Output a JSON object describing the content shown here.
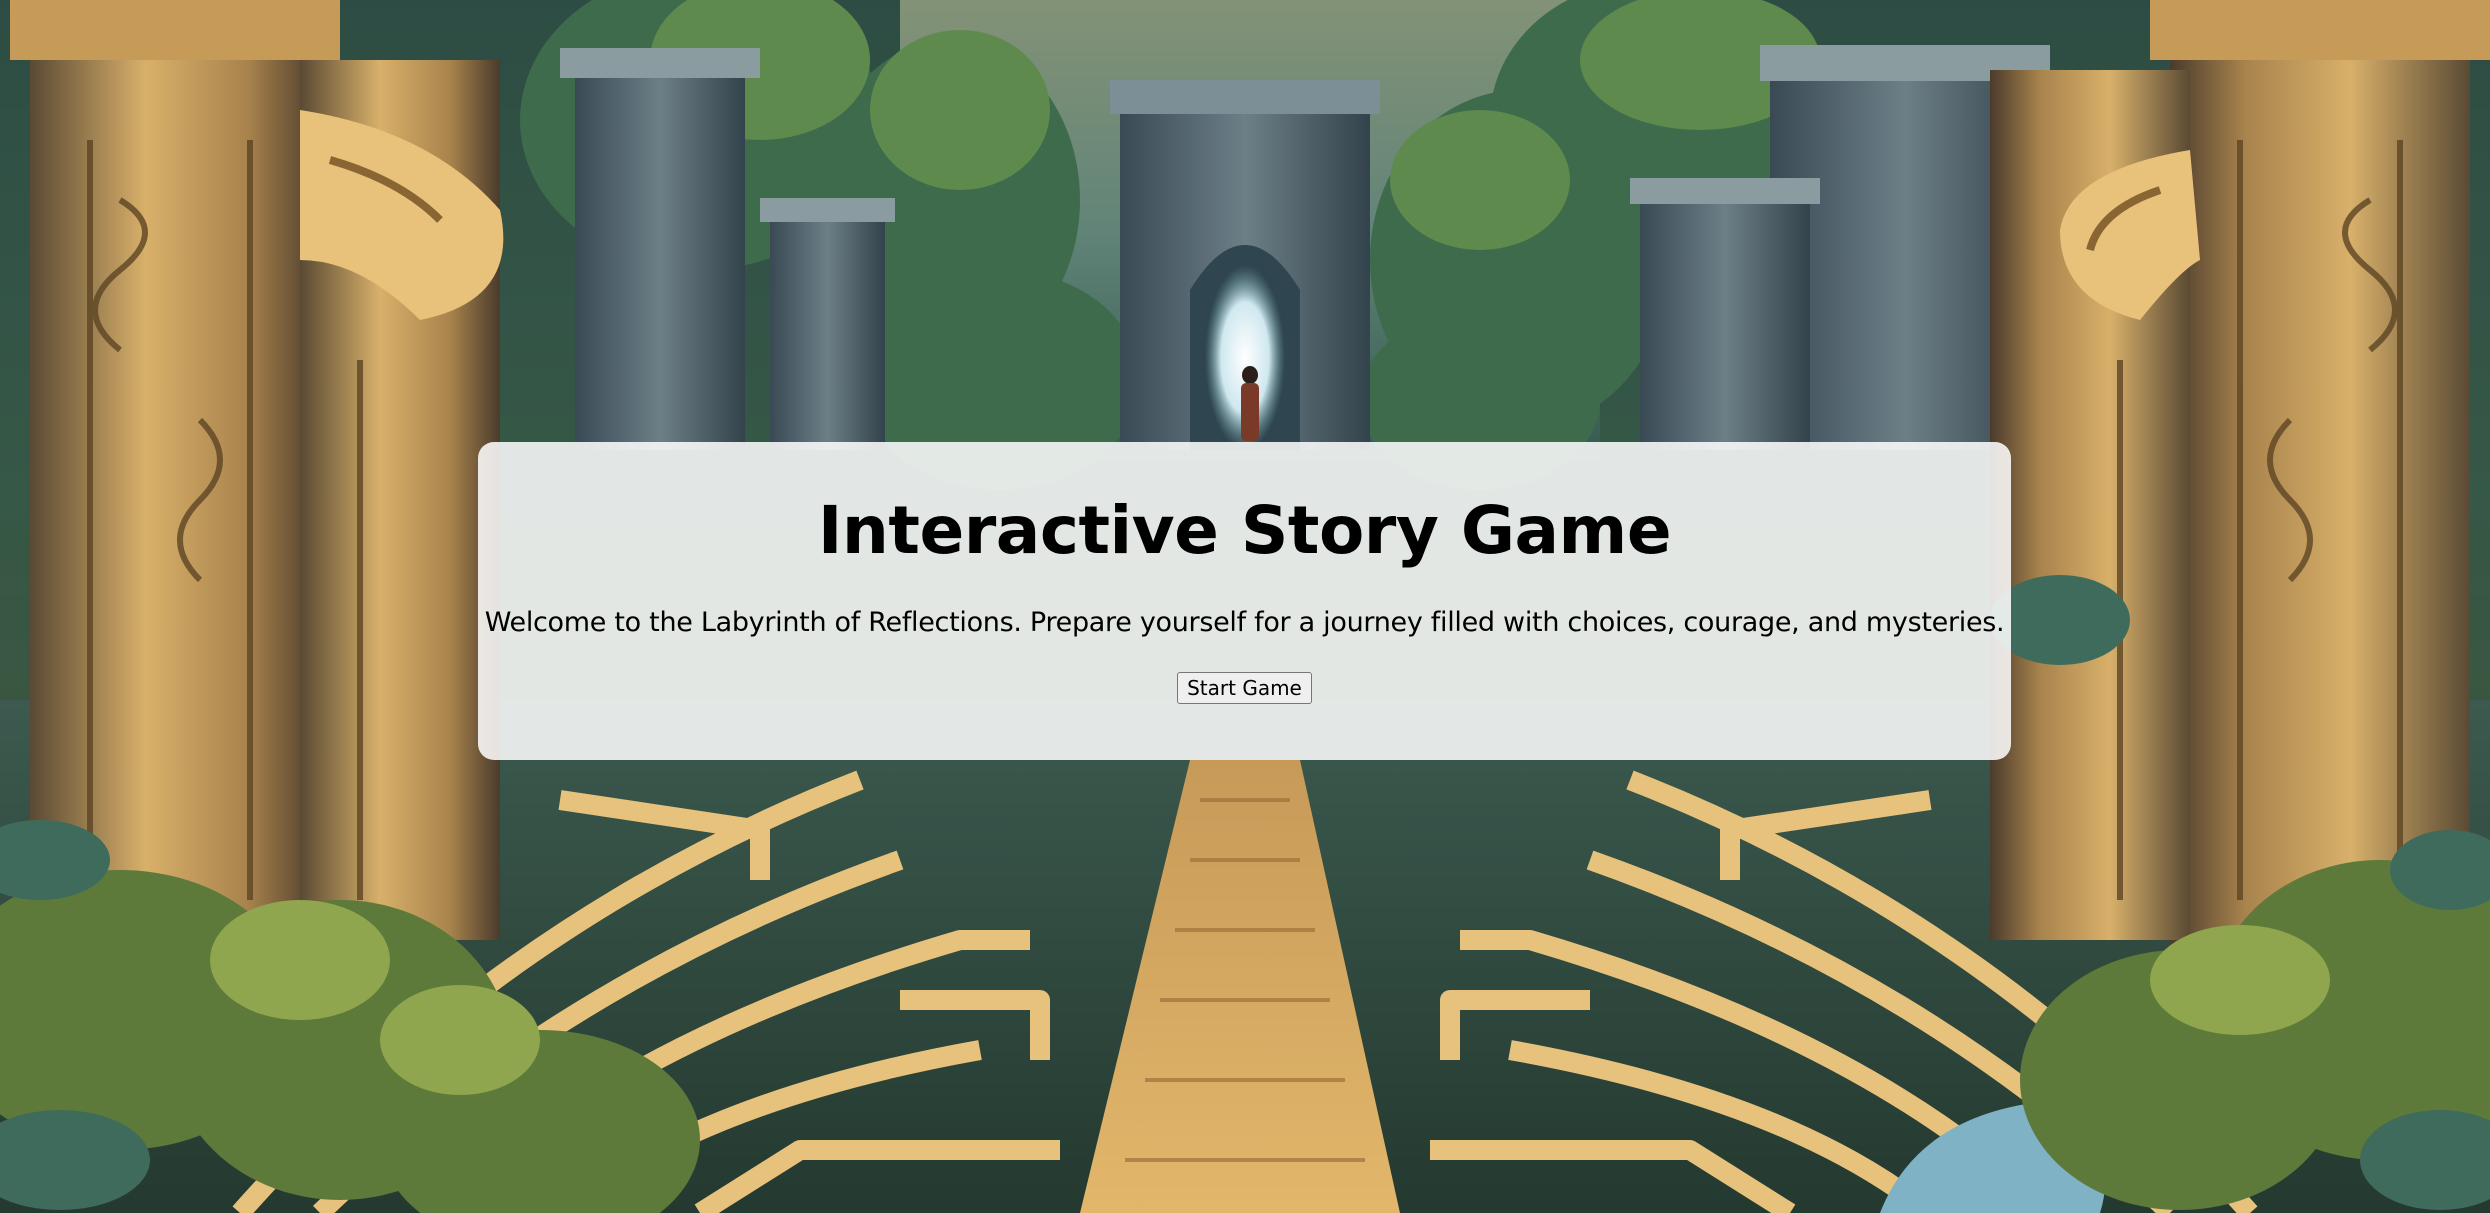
{
  "game": {
    "title": "Interactive Story Game",
    "intro": "Welcome to the Labyrinth of Reflections. Prepare yourself for a journey filled with choices, courage, and mysteries.",
    "start_label": "Start Game"
  }
}
